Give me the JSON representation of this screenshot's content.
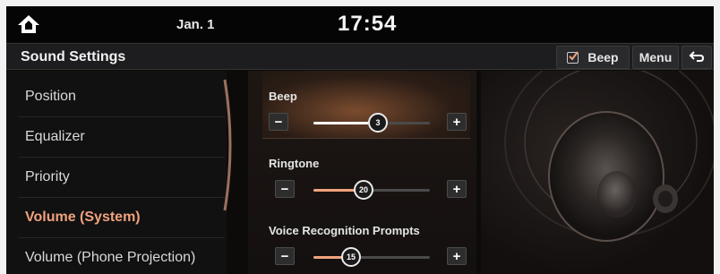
{
  "status_bar": {
    "date": "Jan. 1",
    "time": "17:54"
  },
  "header": {
    "title": "Sound Settings",
    "beep_label": "Beep",
    "beep_checked": true,
    "menu_label": "Menu"
  },
  "left_menu": {
    "items": [
      {
        "label": "Position",
        "active": false
      },
      {
        "label": "Equalizer",
        "active": false
      },
      {
        "label": "Priority",
        "active": false
      },
      {
        "label": "Volume (System)",
        "active": true
      },
      {
        "label": "Volume (Phone Projection)",
        "active": false
      }
    ]
  },
  "sliders": [
    {
      "label": "Beep",
      "value": "3",
      "fraction": 0.55,
      "highlighted": true,
      "fill_color": "#ffffff"
    },
    {
      "label": "Ringtone",
      "value": "20",
      "fraction": 0.43,
      "highlighted": false,
      "fill_color": "#f0a37c"
    },
    {
      "label": "Voice Recognition Prompts",
      "value": "15",
      "fraction": 0.32,
      "highlighted": false,
      "fill_color": "#f0a37c"
    }
  ],
  "icons": {
    "home": "home-icon",
    "back": "back-arrow-icon",
    "checkbox": "checkbox-checked-icon",
    "minus": "minus-icon",
    "plus": "plus-icon"
  },
  "colors": {
    "accent": "#f0a37c",
    "background": "#0d0b0a"
  }
}
